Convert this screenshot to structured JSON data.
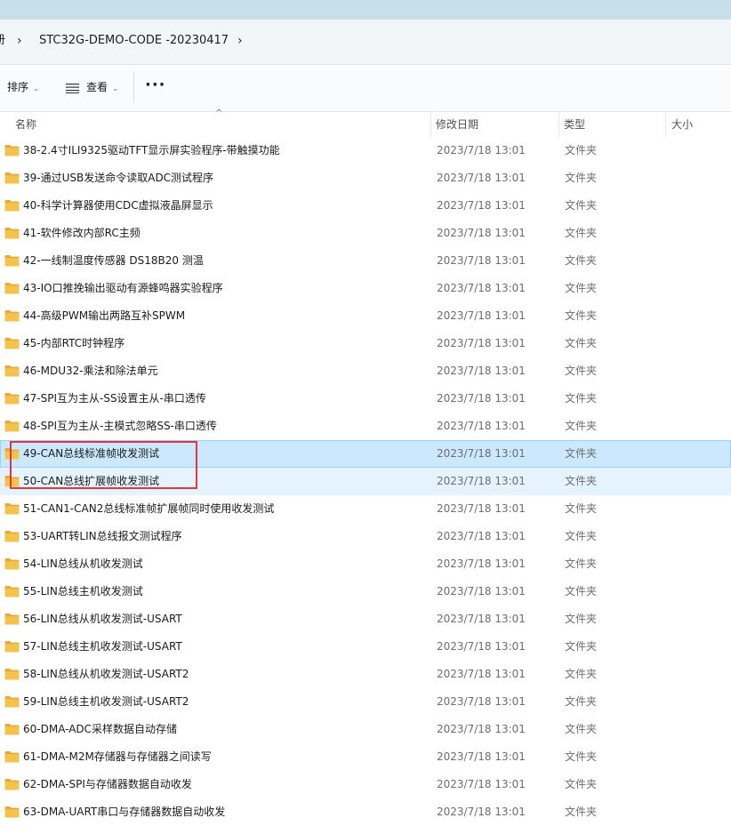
{
  "breadcrumb": {
    "prev_fragment": "册",
    "current": "STC32G-DEMO-CODE -20230417"
  },
  "toolbar": {
    "sort_label": "排序",
    "view_label": "查看",
    "more_label": "···"
  },
  "columns": {
    "name": "名称",
    "modified": "修改日期",
    "type": "类型",
    "size": "大小"
  },
  "colors": {
    "selected_bg": "#cce8ff",
    "hover_bg": "#e5f3ff",
    "highlight_box": "#e5353d",
    "folder": "#f4c34c"
  },
  "files": [
    {
      "name": "38-2.4寸ILI9325驱动TFT显示屏实验程序-带触摸功能",
      "date": "2023/7/18 13:01",
      "type": "文件夹"
    },
    {
      "name": "39-通过USB发送命令读取ADC测试程序",
      "date": "2023/7/18 13:01",
      "type": "文件夹"
    },
    {
      "name": "40-科学计算器使用CDC虚拟液晶屏显示",
      "date": "2023/7/18 13:01",
      "type": "文件夹"
    },
    {
      "name": "41-软件修改内部RC主频",
      "date": "2023/7/18 13:01",
      "type": "文件夹"
    },
    {
      "name": "42-一线制温度传感器 DS18B20 测温",
      "date": "2023/7/18 13:01",
      "type": "文件夹"
    },
    {
      "name": "43-IO口推挽输出驱动有源蜂鸣器实验程序",
      "date": "2023/7/18 13:01",
      "type": "文件夹"
    },
    {
      "name": "44-高级PWM输出两路互补SPWM",
      "date": "2023/7/18 13:01",
      "type": "文件夹"
    },
    {
      "name": "45-内部RTC时钟程序",
      "date": "2023/7/18 13:01",
      "type": "文件夹"
    },
    {
      "name": "46-MDU32-乘法和除法单元",
      "date": "2023/7/18 13:01",
      "type": "文件夹"
    },
    {
      "name": "47-SPI互为主从-SS设置主从-串口透传",
      "date": "2023/7/18 13:01",
      "type": "文件夹"
    },
    {
      "name": "48-SPI互为主从-主模式忽略SS-串口透传",
      "date": "2023/7/18 13:01",
      "type": "文件夹"
    },
    {
      "name": "49-CAN总线标准帧收发测试",
      "date": "2023/7/18 13:01",
      "type": "文件夹"
    },
    {
      "name": "50-CAN总线扩展帧收发测试",
      "date": "2023/7/18 13:01",
      "type": "文件夹"
    },
    {
      "name": "51-CAN1-CAN2总线标准帧扩展帧同时使用收发测试",
      "date": "2023/7/18 13:01",
      "type": "文件夹"
    },
    {
      "name": "53-UART转LIN总线报文测试程序",
      "date": "2023/7/18 13:01",
      "type": "文件夹"
    },
    {
      "name": "54-LIN总线从机收发测试",
      "date": "2023/7/18 13:01",
      "type": "文件夹"
    },
    {
      "name": "55-LIN总线主机收发测试",
      "date": "2023/7/18 13:01",
      "type": "文件夹"
    },
    {
      "name": "56-LIN总线从机收发测试-USART",
      "date": "2023/7/18 13:01",
      "type": "文件夹"
    },
    {
      "name": "57-LIN总线主机收发测试-USART",
      "date": "2023/7/18 13:01",
      "type": "文件夹"
    },
    {
      "name": "58-LIN总线从机收发测试-USART2",
      "date": "2023/7/18 13:01",
      "type": "文件夹"
    },
    {
      "name": "59-LIN总线主机收发测试-USART2",
      "date": "2023/7/18 13:01",
      "type": "文件夹"
    },
    {
      "name": "60-DMA-ADC采样数据自动存储",
      "date": "2023/7/18 13:01",
      "type": "文件夹"
    },
    {
      "name": "61-DMA-M2M存储器与存储器之间读写",
      "date": "2023/7/18 13:01",
      "type": "文件夹"
    },
    {
      "name": "62-DMA-SPI与存储器数据自动收发",
      "date": "2023/7/18 13:01",
      "type": "文件夹"
    },
    {
      "name": "63-DMA-UART串口与存储器数据自动收发",
      "date": "2023/7/18 13:01",
      "type": "文件夹"
    }
  ],
  "selected_index": 11,
  "hover_index": 12
}
